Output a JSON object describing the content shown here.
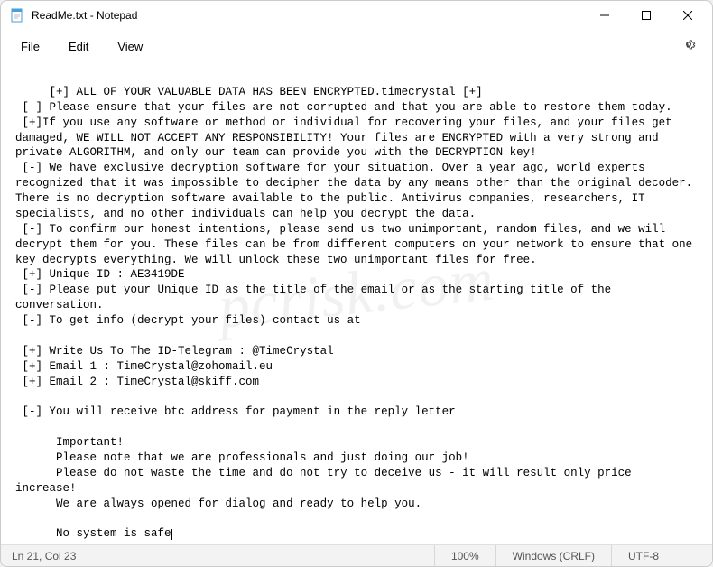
{
  "window": {
    "title": "ReadMe.txt - Notepad"
  },
  "menu": {
    "file": "File",
    "edit": "Edit",
    "view": "View"
  },
  "content": {
    "text": " [+] ALL OF YOUR VALUABLE DATA HAS BEEN ENCRYPTED.timecrystal [+]\n [-] Please ensure that your files are not corrupted and that you are able to restore them today.\n [+]If you use any software or method or individual for recovering your files, and your files get damaged, WE WILL NOT ACCEPT ANY RESPONSIBILITY! Your files are ENCRYPTED with a very strong and private ALGORITHM, and only our team can provide you with the DECRYPTION key!\n [-] We have exclusive decryption software for your situation. Over a year ago, world experts recognized that it was impossible to decipher the data by any means other than the original decoder. There is no decryption software available to the public. Antivirus companies, researchers, IT specialists, and no other individuals can help you decrypt the data.\n [-] To confirm our honest intentions, please send us two unimportant, random files, and we will decrypt them for you. These files can be from different computers on your network to ensure that one key decrypts everything. We will unlock these two unimportant files for free.\n [+] Unique-ID : AE3419DE\n [-] Please put your Unique ID as the title of the email or as the starting title of the conversation.\n [-] To get info (decrypt your files) contact us at\n\n [+] Write Us To The ID-Telegram : @TimeCrystal\n [+] Email 1 : TimeCrystal@zohomail.eu\n [+] Email 2 : TimeCrystal@skiff.com\n\n [-] You will receive btc address for payment in the reply letter\n\n      Important!\n      Please note that we are professionals and just doing our job!\n      Please do not waste the time and do not try to deceive us - it will result only price increase!\n      We are always opened for dialog and ready to help you.\n\n      No system is safe"
  },
  "statusbar": {
    "position": "Ln 21, Col 23",
    "zoom": "100%",
    "line_ending": "Windows (CRLF)",
    "encoding": "UTF-8"
  },
  "watermark": "pcrisk.com"
}
